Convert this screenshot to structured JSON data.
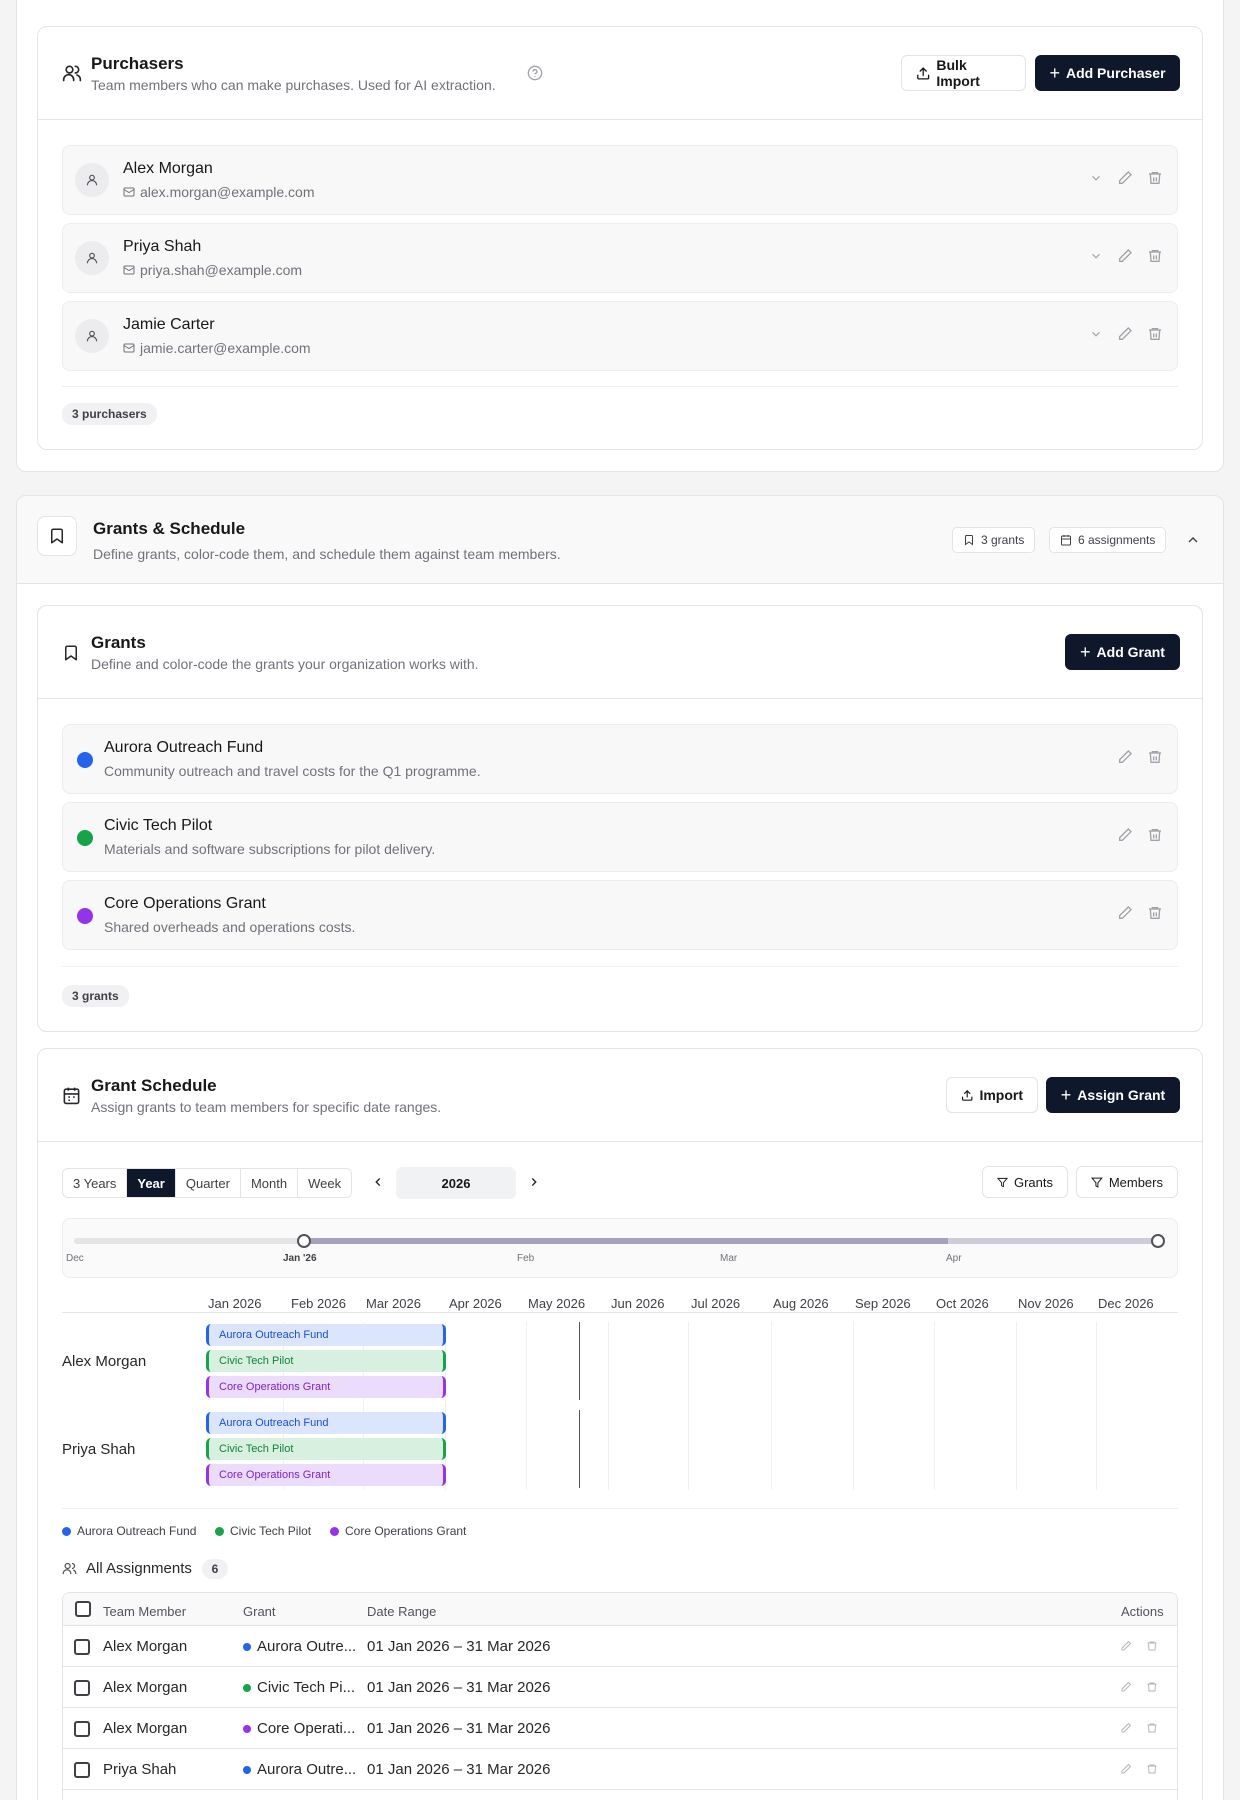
{
  "purchasers": {
    "title": "Purchasers",
    "subtitle": "Team members who can make purchases. Used for AI extraction.",
    "bulk_import_label": "Bulk Import",
    "add_label": "Add Purchaser",
    "items": [
      {
        "name": "Alex Morgan",
        "email": "alex.morgan@example.com"
      },
      {
        "name": "Priya Shah",
        "email": "priya.shah@example.com"
      },
      {
        "name": "Jamie Carter",
        "email": "jamie.carter@example.com"
      }
    ],
    "count_label": "3 purchasers"
  },
  "grants_section": {
    "title": "Grants & Schedule",
    "subtitle": "Define grants, color-code them, and schedule them against team members.",
    "grants_badge": "3 grants",
    "assignments_badge": "6 assignments"
  },
  "grants": {
    "title": "Grants",
    "subtitle": "Define and color-code the grants your organization works with.",
    "add_label": "Add Grant",
    "items": [
      {
        "name": "Aurora Outreach Fund",
        "description": "Community outreach and travel costs for the Q1 programme.",
        "color": "#2563eb"
      },
      {
        "name": "Civic Tech Pilot",
        "description": "Materials and software subscriptions for pilot delivery.",
        "color": "#16a34a"
      },
      {
        "name": "Core Operations Grant",
        "description": "Shared overheads and operations costs.",
        "color": "#9333ea"
      }
    ],
    "count_label": "3 grants"
  },
  "schedule": {
    "title": "Grant Schedule",
    "subtitle": "Assign grants to team members for specific date ranges.",
    "import_label": "Import",
    "assign_label": "Assign Grant",
    "views": [
      "3 Years",
      "Year",
      "Quarter",
      "Month",
      "Week"
    ],
    "active_view": "Year",
    "period": "2026",
    "filter_grants": "Grants",
    "filter_members": "Members",
    "range_labels": [
      "Dec",
      "Jan '26",
      "Feb",
      "Mar",
      "Apr"
    ],
    "months": [
      "Jan 2026",
      "Feb 2026",
      "Mar 2026",
      "Apr 2026",
      "May 2026",
      "Jun 2026",
      "Jul 2026",
      "Aug 2026",
      "Sep 2026",
      "Oct 2026",
      "Nov 2026",
      "Dec 2026"
    ],
    "rows": [
      {
        "member": "Alex Morgan",
        "bars": [
          "Aurora Outreach Fund",
          "Civic Tech Pilot",
          "Core Operations Grant"
        ]
      },
      {
        "member": "Priya Shah",
        "bars": [
          "Aurora Outreach Fund",
          "Civic Tech Pilot",
          "Core Operations Grant"
        ]
      }
    ],
    "legend": [
      "Aurora Outreach Fund",
      "Civic Tech Pilot",
      "Core Operations Grant"
    ]
  },
  "assignments": {
    "title": "All Assignments",
    "count": "6",
    "columns": {
      "member": "Team Member",
      "grant": "Grant",
      "range": "Date Range",
      "actions": "Actions"
    },
    "rows": [
      {
        "member": "Alex Morgan",
        "grant": "Aurora Outre...",
        "range": "01 Jan 2026 – 31 Mar 2026",
        "color": "#2563eb"
      },
      {
        "member": "Alex Morgan",
        "grant": "Civic Tech Pi...",
        "range": "01 Jan 2026 – 31 Mar 2026",
        "color": "#16a34a"
      },
      {
        "member": "Alex Morgan",
        "grant": "Core Operati...",
        "range": "01 Jan 2026 – 31 Mar 2026",
        "color": "#9333ea"
      },
      {
        "member": "Priya Shah",
        "grant": "Aurora Outre...",
        "range": "01 Jan 2026 – 31 Mar 2026",
        "color": "#2563eb"
      }
    ]
  }
}
